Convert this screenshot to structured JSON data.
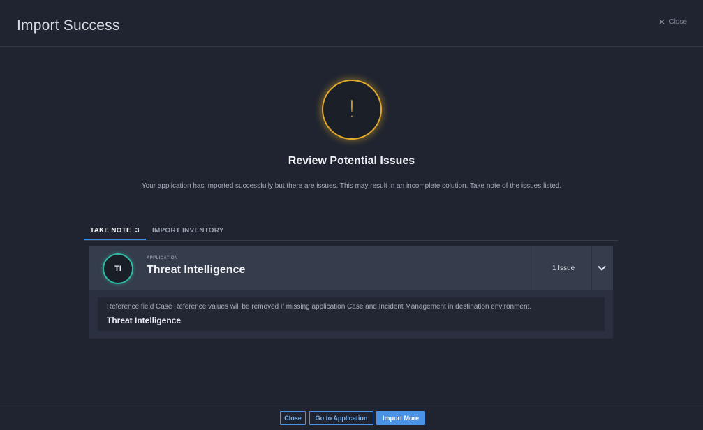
{
  "header": {
    "title": "Import Success",
    "close_label": "Close",
    "close_icon": "close-icon"
  },
  "status": {
    "icon": "warning-icon",
    "icon_glyph": "!",
    "heading": "Review Potential Issues",
    "message": "Your application has imported successfully but there are issues. This may result in an incomplete solution. Take note of the issues listed."
  },
  "tabs": [
    {
      "label": "TAKE NOTE",
      "count": "3",
      "active": true
    },
    {
      "label": "IMPORT INVENTORY",
      "active": false
    }
  ],
  "card": {
    "avatar_initials": "TI",
    "type_label": "APPLICATION",
    "name": "Threat Intelligence",
    "issue_count": "1 Issue",
    "note_text": "Reference field Case Reference values will be removed if missing application Case and Incident Management in destination environment.",
    "note_app": "Threat Intelligence"
  },
  "footer": {
    "close_label": "Close",
    "goto_label": "Go to Application",
    "import_more_label": "Import More"
  },
  "colors": {
    "background": "#1f2430",
    "warning": "#e1a92b",
    "accent": "#4a93e6",
    "avatar_ring": "#2fb8a3"
  }
}
